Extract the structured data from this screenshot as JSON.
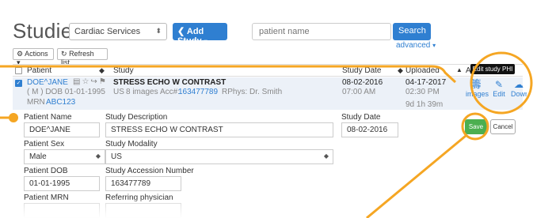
{
  "header": {
    "title": "Studies",
    "facility": "Cardiac Services",
    "add_study": "Add Study",
    "search_placeholder": "patient name",
    "search_button": "Search",
    "advanced": "advanced"
  },
  "toolbar": {
    "actions": "Actions",
    "refresh": "Refresh list"
  },
  "table": {
    "columns": {
      "patient": "Patient",
      "study": "Study",
      "study_date": "Study Date",
      "uploaded": "Uploaded",
      "actions": "Ac"
    },
    "row": {
      "name": "DOE^JANE",
      "sex_dob": "( M ) DOB 01-01-1995",
      "mrn_label": "MRN",
      "mrn": "ABC123",
      "study_title": "STRESS ECHO W CONTRAST",
      "modality": "US",
      "images": "8 images",
      "acc_label": "Acc#:",
      "acc": "163477789",
      "rphys": "RPhys: Dr. Smith",
      "study_date": "08-02-2016",
      "study_time": "07:00 AM",
      "uploaded_date": "04-17-2017",
      "uploaded_time": "02:30 PM",
      "age": "9d 1h 39m"
    },
    "actions": {
      "images": "images",
      "edit": "Edit",
      "download": "Down",
      "tooltip": "Edit study PHI"
    }
  },
  "form": {
    "patient_name_label": "Patient Name",
    "patient_name": "DOE^JANE",
    "study_desc_label": "Study Description",
    "study_desc": "STRESS ECHO W CONTRAST",
    "study_date_label": "Study Date",
    "study_date": "08-02-2016",
    "sex_label": "Patient Sex",
    "sex": "Male",
    "modality_label": "Study Modality",
    "modality": "US",
    "dob_label": "Patient DOB",
    "dob": "01-01-1995",
    "acc_label": "Study Accession Number",
    "acc": "163477789",
    "mrn_label": "Patient MRN",
    "ref_label": "Referring physician",
    "save": "Save",
    "cancel": "Cancel"
  },
  "colors": {
    "accent": "#2f7fd1",
    "highlight": "#f5a623",
    "save": "#4caf50",
    "row_bg": "#ecf1f8"
  }
}
